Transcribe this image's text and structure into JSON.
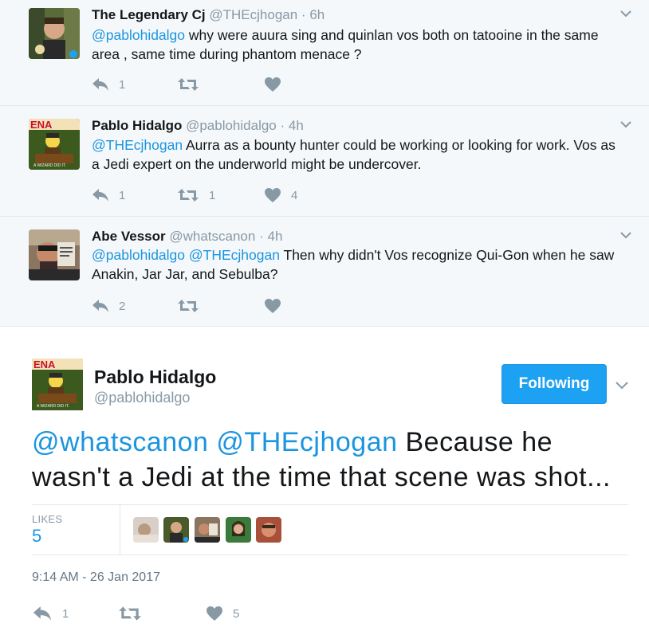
{
  "replies": [
    {
      "name": "The Legendary Cj",
      "handle": "@THEcjhogan",
      "dot": "·",
      "time": "6h",
      "mentions": "@pablohidalgo",
      "text": " why were auura sing and quinlan vos both on tatooine in the same area , same time during phantom menace ?",
      "reply_count": "1",
      "retweet_count": "",
      "like_count": ""
    },
    {
      "name": "Pablo Hidalgo",
      "handle": "@pablohidalgo",
      "dot": "·",
      "time": "4h",
      "mentions": "@THEcjhogan",
      "text": " Aurra as a bounty hunter could be working or looking for work. Vos as a Jedi expert on the underworld might be undercover.",
      "reply_count": "1",
      "retweet_count": "1",
      "like_count": "4"
    },
    {
      "name": "Abe Vessor",
      "handle": "@whatscanon",
      "dot": "·",
      "time": "4h",
      "mentions": "@pablohidalgo @THEcjhogan",
      "text": " Then why didn't Vos recognize Qui-Gon when he saw Anakin, Jar Jar, and Sebulba?",
      "reply_count": "2",
      "retweet_count": "",
      "like_count": ""
    }
  ],
  "main_tweet": {
    "name": "Pablo Hidalgo",
    "handle": "@pablohidalgo",
    "follow_label": "Following",
    "mentions": "@whatscanon @THEcjhogan",
    "text": " Because he wasn't a Jedi at the time that scene was shot...",
    "likes_label": "LIKES",
    "likes_count": "5",
    "timestamp": "9:14 AM - 26 Jan 2017",
    "reply_count": "1",
    "retweet_count": "",
    "like_count": "5"
  },
  "colors": {
    "accent": "#1b95e0",
    "button": "#1da1f2",
    "muted": "#8899a6",
    "reply_bg": "#f5f8fa"
  },
  "icons": {
    "reply": "reply-icon",
    "retweet": "retweet-icon",
    "like": "heart-icon",
    "more": "chevron-down-icon"
  }
}
